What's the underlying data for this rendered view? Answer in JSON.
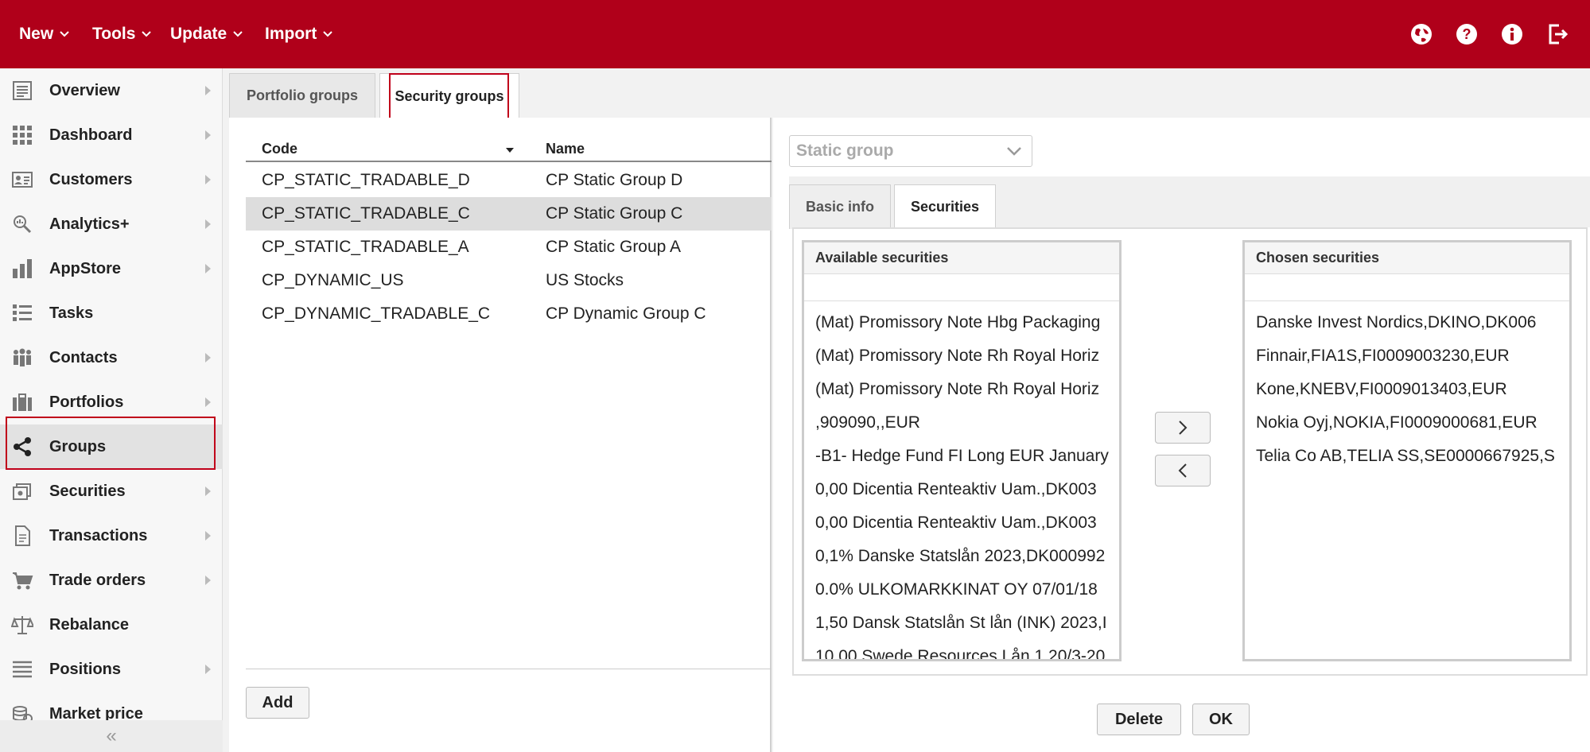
{
  "colors": {
    "brand": "#b0001a",
    "highlight": "#c0001a"
  },
  "topbar": {
    "menus": [
      {
        "label": "New"
      },
      {
        "label": "Tools"
      },
      {
        "label": "Update"
      },
      {
        "label": "Import"
      }
    ],
    "icons": [
      "globe-icon",
      "help-icon",
      "info-icon",
      "logout-icon"
    ]
  },
  "sidebar": {
    "items": [
      {
        "label": "Overview",
        "icon": "overview-icon"
      },
      {
        "label": "Dashboard",
        "icon": "dashboard-icon"
      },
      {
        "label": "Customers",
        "icon": "customers-icon"
      },
      {
        "label": "Analytics+",
        "icon": "analytics-icon"
      },
      {
        "label": "AppStore",
        "icon": "appstore-icon"
      },
      {
        "label": "Tasks",
        "icon": "tasks-icon"
      },
      {
        "label": "Contacts",
        "icon": "contacts-icon"
      },
      {
        "label": "Portfolios",
        "icon": "portfolios-icon"
      },
      {
        "label": "Groups",
        "icon": "share-icon"
      },
      {
        "label": "Securities",
        "icon": "securities-icon"
      },
      {
        "label": "Transactions",
        "icon": "transactions-icon"
      },
      {
        "label": "Trade orders",
        "icon": "cart-icon"
      },
      {
        "label": "Rebalance",
        "icon": "scale-icon"
      },
      {
        "label": "Positions",
        "icon": "positions-icon"
      },
      {
        "label": "Market price",
        "icon": "coins-icon"
      }
    ],
    "collapse_label": "«"
  },
  "main": {
    "tabs": [
      {
        "label": "Portfolio groups"
      },
      {
        "label": "Security groups"
      }
    ],
    "table": {
      "columns": [
        "Code",
        "Name"
      ],
      "rows": [
        {
          "code": "CP_STATIC_TRADABLE_D",
          "name": "CP Static Group D"
        },
        {
          "code": "CP_STATIC_TRADABLE_C",
          "name": "CP Static Group C"
        },
        {
          "code": "CP_STATIC_TRADABLE_A",
          "name": "CP Static Group A"
        },
        {
          "code": "CP_DYNAMIC_US",
          "name": "US Stocks"
        },
        {
          "code": "CP_DYNAMIC_TRADABLE_C",
          "name": "CP Dynamic Group C"
        }
      ]
    },
    "add_label": "Add"
  },
  "detail": {
    "group_type": "Static group",
    "subtabs": [
      {
        "label": "Basic info"
      },
      {
        "label": "Securities"
      }
    ],
    "available": {
      "title": "Available securities",
      "items": [
        "(Mat) Promissory Note Hbg Packaging",
        "(Mat) Promissory Note Rh Royal Horiz",
        "(Mat) Promissory Note Rh Royal Horiz",
        ",909090,,EUR",
        "-B1- Hedge Fund FI Long EUR January",
        "0,00 Dicentia Renteaktiv Uam.,DK003",
        "0,00 Dicentia Renteaktiv Uam.,DK003",
        "0,1% Danske Statslån 2023,DK000992",
        "0.0% ULKOMARKKINAT OY 07/01/18",
        "1,50 Dansk Statslån St lån (INK) 2023,I",
        "10.00 Swede Resources Lån 1 20/3-20"
      ]
    },
    "chosen": {
      "title": "Chosen securities",
      "items": [
        "Danske Invest Nordics,DKINO,DK006",
        "Finnair,FIA1S,FI0009003230,EUR",
        "Kone,KNEBV,FI0009013403,EUR",
        "Nokia Oyj,NOKIA,FI0009000681,EUR",
        "Telia Co AB,TELIA SS,SE0000667925,S"
      ]
    },
    "delete_label": "Delete",
    "ok_label": "OK"
  }
}
